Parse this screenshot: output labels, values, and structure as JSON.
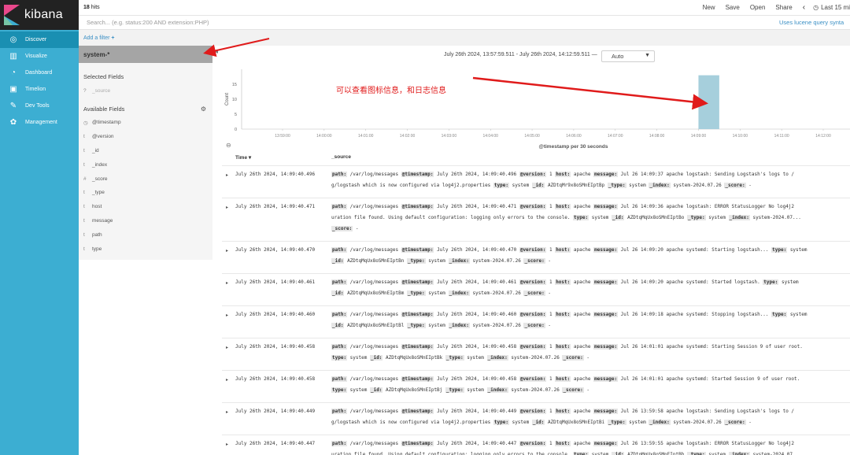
{
  "nav": {
    "logo_text": "kibana",
    "items": [
      {
        "label": "Discover",
        "icon": "compass-icon",
        "glyph": "◎",
        "active": true
      },
      {
        "label": "Visualize",
        "icon": "bar-chart-icon",
        "glyph": "▥",
        "active": false
      },
      {
        "label": "Dashboard",
        "icon": "dashboard-icon",
        "glyph": "◔",
        "active": false
      },
      {
        "label": "Timelion",
        "icon": "timelion-icon",
        "glyph": "▣",
        "active": false
      },
      {
        "label": "Dev Tools",
        "icon": "wrench-icon",
        "glyph": "✎",
        "active": false
      },
      {
        "label": "Management",
        "icon": "gear-icon",
        "glyph": "✿",
        "active": false
      }
    ]
  },
  "topbar": {
    "hits_count": "18",
    "hits_label": "hits",
    "new": "New",
    "save": "Save",
    "open": "Open",
    "share": "Share",
    "prev_arrow": "‹",
    "time_range": "Last 15 mi"
  },
  "search": {
    "placeholder": "Search... (e.g. status:200 AND extension:PHP)",
    "lucene_link": "Uses lucene query synta"
  },
  "filter": {
    "add_filter": "Add a filter",
    "plus": "+"
  },
  "sidebar": {
    "index_pattern": "system-*",
    "selected_fields_title": "Selected Fields",
    "selected_fields": [
      {
        "type": "?",
        "name": "_source"
      }
    ],
    "available_fields_title": "Available Fields",
    "available_fields": [
      {
        "type": "◷",
        "name": "@timestamp"
      },
      {
        "type": "t",
        "name": "@version"
      },
      {
        "type": "t",
        "name": "_id"
      },
      {
        "type": "t",
        "name": "_index"
      },
      {
        "type": "#",
        "name": "_score"
      },
      {
        "type": "t",
        "name": "_type"
      },
      {
        "type": "t",
        "name": "host"
      },
      {
        "type": "t",
        "name": "message"
      },
      {
        "type": "t",
        "name": "path"
      },
      {
        "type": "t",
        "name": "type"
      }
    ]
  },
  "chart_header": {
    "time_range": "July 26th 2024, 13:57:59.511 - July 26th 2024, 14:12:59.511 —",
    "interval": "Auto"
  },
  "chart_data": {
    "type": "bar",
    "ylabel": "Count",
    "xlabel": "@timestamp per 30 seconds",
    "yticks": [
      0,
      5,
      10,
      15
    ],
    "ylim": [
      0,
      20
    ],
    "x_ticks": [
      "13:59:00",
      "14:00:00",
      "14:01:00",
      "14:02:00",
      "14:03:00",
      "14:04:00",
      "14:05:00",
      "14:06:00",
      "14:07:00",
      "14:08:00",
      "14:09:00",
      "14:10:00",
      "14:11:00",
      "14:12:00"
    ],
    "bars": [
      {
        "x": "14:09:30",
        "value": 18
      }
    ],
    "bar_color": "#a6cfdc"
  },
  "annotation": {
    "text": "可以查看图标信息，和日志信息",
    "color": "#e01b1b"
  },
  "table": {
    "time_header": "Time",
    "sort_icon": "▾",
    "source_header": "_source",
    "rows": [
      {
        "time": "July 26th 2024, 14:09:40.496",
        "lines": [
          [
            {
              "k": "path:"
            },
            {
              "v": " /var/log/messages "
            },
            {
              "k": "@timestamp:"
            },
            {
              "v": " July 26th 2024, 14:09:40.496 "
            },
            {
              "k": "@version:"
            },
            {
              "v": " 1 "
            },
            {
              "k": "host:"
            },
            {
              "v": " apache "
            },
            {
              "k": "message:"
            },
            {
              "v": " Jul 26 14:09:37 apache logstash: Sending Logstash's logs to /"
            }
          ],
          [
            {
              "v": "g/logstash which is now configured via log4j2.properties "
            },
            {
              "k": "type:"
            },
            {
              "v": " system "
            },
            {
              "k": "_id:"
            },
            {
              "v": " AZDtqMr9x8oSMnEIptBp "
            },
            {
              "k": "_type:"
            },
            {
              "v": " system "
            },
            {
              "k": "_index:"
            },
            {
              "v": " system-2024.07.26 "
            },
            {
              "k": "_score:"
            },
            {
              "v": " -"
            }
          ]
        ]
      },
      {
        "time": "July 26th 2024, 14:09:40.471",
        "lines": [
          [
            {
              "k": "path:"
            },
            {
              "v": " /var/log/messages "
            },
            {
              "k": "@timestamp:"
            },
            {
              "v": " July 26th 2024, 14:09:40.471 "
            },
            {
              "k": "@version:"
            },
            {
              "v": " 1 "
            },
            {
              "k": "host:"
            },
            {
              "v": " apache "
            },
            {
              "k": "message:"
            },
            {
              "v": " Jul 26 14:09:36 apache logstash: ERROR StatusLogger No log4j2"
            }
          ],
          [
            {
              "v": "uration file found. Using default configuration: logging only errors to the console. "
            },
            {
              "k": "type:"
            },
            {
              "v": " system "
            },
            {
              "k": "_id:"
            },
            {
              "v": " AZDtqMqUx8oSMnEIptBo "
            },
            {
              "k": "_type:"
            },
            {
              "v": " system "
            },
            {
              "k": "_index:"
            },
            {
              "v": " system-2024.07..."
            }
          ],
          [
            {
              "k": "_score:"
            },
            {
              "v": " -"
            }
          ]
        ]
      },
      {
        "time": "July 26th 2024, 14:09:40.470",
        "lines": [
          [
            {
              "k": "path:"
            },
            {
              "v": " /var/log/messages "
            },
            {
              "k": "@timestamp:"
            },
            {
              "v": " July 26th 2024, 14:09:40.470 "
            },
            {
              "k": "@version:"
            },
            {
              "v": " 1 "
            },
            {
              "k": "host:"
            },
            {
              "v": " apache "
            },
            {
              "k": "message:"
            },
            {
              "v": " Jul 26 14:09:20 apache systemd: Starting logstash... "
            },
            {
              "k": "type:"
            },
            {
              "v": " system"
            }
          ],
          [
            {
              "k": "_id:"
            },
            {
              "v": " AZDtqMqUx8oSMnEIptBn "
            },
            {
              "k": "_type:"
            },
            {
              "v": " system "
            },
            {
              "k": "_index:"
            },
            {
              "v": " system-2024.07.26 "
            },
            {
              "k": "_score:"
            },
            {
              "v": " -"
            }
          ]
        ]
      },
      {
        "time": "July 26th 2024, 14:09:40.461",
        "lines": [
          [
            {
              "k": "path:"
            },
            {
              "v": " /var/log/messages "
            },
            {
              "k": "@timestamp:"
            },
            {
              "v": " July 26th 2024, 14:09:40.461 "
            },
            {
              "k": "@version:"
            },
            {
              "v": " 1 "
            },
            {
              "k": "host:"
            },
            {
              "v": " apache "
            },
            {
              "k": "message:"
            },
            {
              "v": " Jul 26 14:09:20 apache systemd: Started logstash. "
            },
            {
              "k": "type:"
            },
            {
              "v": " system"
            }
          ],
          [
            {
              "k": "_id:"
            },
            {
              "v": " AZDtqMqUx8oSMnEIptBm "
            },
            {
              "k": "_type:"
            },
            {
              "v": " system "
            },
            {
              "k": "_index:"
            },
            {
              "v": " system-2024.07.26 "
            },
            {
              "k": "_score:"
            },
            {
              "v": " -"
            }
          ]
        ]
      },
      {
        "time": "July 26th 2024, 14:09:40.460",
        "lines": [
          [
            {
              "k": "path:"
            },
            {
              "v": " /var/log/messages "
            },
            {
              "k": "@timestamp:"
            },
            {
              "v": " July 26th 2024, 14:09:40.460 "
            },
            {
              "k": "@version:"
            },
            {
              "v": " 1 "
            },
            {
              "k": "host:"
            },
            {
              "v": " apache "
            },
            {
              "k": "message:"
            },
            {
              "v": " Jul 26 14:09:18 apache systemd: Stopping logstash... "
            },
            {
              "k": "type:"
            },
            {
              "v": " system"
            }
          ],
          [
            {
              "k": "_id:"
            },
            {
              "v": " AZDtqMqUx8oSMnEIptBl "
            },
            {
              "k": "_type:"
            },
            {
              "v": " system "
            },
            {
              "k": "_index:"
            },
            {
              "v": " system-2024.07.26 "
            },
            {
              "k": "_score:"
            },
            {
              "v": " -"
            }
          ]
        ]
      },
      {
        "time": "July 26th 2024, 14:09:40.458",
        "lines": [
          [
            {
              "k": "path:"
            },
            {
              "v": " /var/log/messages "
            },
            {
              "k": "@timestamp:"
            },
            {
              "v": " July 26th 2024, 14:09:40.458 "
            },
            {
              "k": "@version:"
            },
            {
              "v": " 1 "
            },
            {
              "k": "host:"
            },
            {
              "v": " apache "
            },
            {
              "k": "message:"
            },
            {
              "v": " Jul 26 14:01:01 apache systemd: Starting Session 9 of user root."
            }
          ],
          [
            {
              "k": "type:"
            },
            {
              "v": " system "
            },
            {
              "k": "_id:"
            },
            {
              "v": " AZDtqMqUx8oSMnEIptBk "
            },
            {
              "k": "_type:"
            },
            {
              "v": " system "
            },
            {
              "k": "_index:"
            },
            {
              "v": " system-2024.07.26 "
            },
            {
              "k": "_score:"
            },
            {
              "v": " -"
            }
          ]
        ]
      },
      {
        "time": "July 26th 2024, 14:09:40.458",
        "lines": [
          [
            {
              "k": "path:"
            },
            {
              "v": " /var/log/messages "
            },
            {
              "k": "@timestamp:"
            },
            {
              "v": " July 26th 2024, 14:09:40.458 "
            },
            {
              "k": "@version:"
            },
            {
              "v": " 1 "
            },
            {
              "k": "host:"
            },
            {
              "v": " apache "
            },
            {
              "k": "message:"
            },
            {
              "v": " Jul 26 14:01:01 apache systemd: Started Session 9 of user root."
            }
          ],
          [
            {
              "k": "type:"
            },
            {
              "v": " system "
            },
            {
              "k": "_id:"
            },
            {
              "v": " AZDtqMqUx8oSMnEIptBj "
            },
            {
              "k": "_type:"
            },
            {
              "v": " system "
            },
            {
              "k": "_index:"
            },
            {
              "v": " system-2024.07.26 "
            },
            {
              "k": "_score:"
            },
            {
              "v": " -"
            }
          ]
        ]
      },
      {
        "time": "July 26th 2024, 14:09:40.449",
        "lines": [
          [
            {
              "k": "path:"
            },
            {
              "v": " /var/log/messages "
            },
            {
              "k": "@timestamp:"
            },
            {
              "v": " July 26th 2024, 14:09:40.449 "
            },
            {
              "k": "@version:"
            },
            {
              "v": " 1 "
            },
            {
              "k": "host:"
            },
            {
              "v": " apache "
            },
            {
              "k": "message:"
            },
            {
              "v": " Jul 26 13:59:58 apache logstash: Sending Logstash's logs to /"
            }
          ],
          [
            {
              "v": "g/logstash which is now configured via log4j2.properties "
            },
            {
              "k": "type:"
            },
            {
              "v": " system "
            },
            {
              "k": "_id:"
            },
            {
              "v": " AZDtqMqUx8oSMnEIptBi "
            },
            {
              "k": "_type:"
            },
            {
              "v": " system "
            },
            {
              "k": "_index:"
            },
            {
              "v": " system-2024.07.26 "
            },
            {
              "k": "_score:"
            },
            {
              "v": " -"
            }
          ]
        ]
      },
      {
        "time": "July 26th 2024, 14:09:40.447",
        "lines": [
          [
            {
              "k": "path:"
            },
            {
              "v": " /var/log/messages "
            },
            {
              "k": "@timestamp:"
            },
            {
              "v": " July 26th 2024, 14:09:40.447 "
            },
            {
              "k": "@version:"
            },
            {
              "v": " 1 "
            },
            {
              "k": "host:"
            },
            {
              "v": " apache "
            },
            {
              "k": "message:"
            },
            {
              "v": " Jul 26 13:59:55 apache logstash: ERROR StatusLogger No log4j2"
            }
          ],
          [
            {
              "v": "uration file found. Using default configuration: logging only errors to the console. "
            },
            {
              "k": "type:"
            },
            {
              "v": " system "
            },
            {
              "k": "_id:"
            },
            {
              "v": " AZDtqMqUx8oSMnEIptBh "
            },
            {
              "k": "_type:"
            },
            {
              "v": " system "
            },
            {
              "k": "_index:"
            },
            {
              "v": " system-2024.07..."
            }
          ]
        ]
      }
    ]
  }
}
